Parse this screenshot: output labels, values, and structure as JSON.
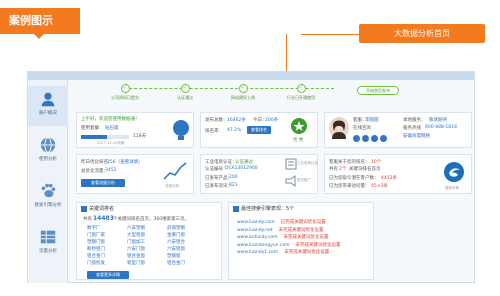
{
  "header": {
    "badge": "案例图示",
    "callout": "大数据分析首页"
  },
  "sidebar": {
    "items": [
      {
        "label": "账户概况",
        "icon": "user-icon"
      },
      {
        "label": "使用分析",
        "icon": "globe-icon"
      },
      {
        "label": "搜索引擎分析",
        "icon": "paw-icon"
      },
      {
        "label": "流量分析",
        "icon": "grid-icon"
      }
    ]
  },
  "steps": {
    "items": [
      "公司资料已提交",
      "认证通过",
      "网站建好上线",
      "行业已开通使用"
    ],
    "last": "开始首页发布"
  },
  "account": {
    "greeting": "上午好，欢迎您使用数据通！",
    "package_label": "使用套餐：",
    "package_value": "钻石版",
    "usage_pct": 0.55,
    "days": "118天",
    "expiry": "2017-11-15到期",
    "icon": "lightbulb-icon"
  },
  "stats": {
    "posts_label": "发布总数：",
    "posts_value": "16462条",
    "today_label": "今日：",
    "today_value": "200条",
    "rate_label": "排名率：",
    "rate_value": "47.2%",
    "rate_btn": "查看排名",
    "rank_label": "优 秀"
  },
  "advisor": {
    "label": "客服：",
    "name": "李圆圆",
    "phone_label": "电话：",
    "online_label": "在线咨询",
    "qq_label": "QQ咨询",
    "support": "本地服务：",
    "support_value": "敬请期待",
    "hotline_label": "服务热线",
    "hotline": "400-888-1818",
    "hotline_2": "安徽商盟网络"
  },
  "traffic": {
    "yesterday_label": "昨日优化排名：",
    "yesterday_value": "156（查看详情）",
    "total_label": "总优化流量：",
    "total_value": "3452",
    "btn": "查看流量分析",
    "chart_label": "流量分析"
  },
  "business": {
    "license_label": "工业电商认证：",
    "license_value": "认证通过",
    "cert_label": "认证编号：",
    "cert_value": "DCA13012900",
    "pages_label": "已发布产品：",
    "pages_value": "200",
    "news_label": "已发布资讯：",
    "news_value": "823",
    "icon1": "工业电商认证",
    "icon2": "发布推广"
  },
  "promo": {
    "line1_label": "客服关于您的排名：",
    "line1_value": "10个",
    "line2_label": "共有",
    "line2_value": "2个",
    "line2_tail": "关键词排名首页",
    "line3_label": "已为您吸引潜在客户数：",
    "line3_value": "4452条",
    "line4_label": "已为您带来访问量：",
    "line4_value": "45×3条",
    "logo": "搜索引擎"
  },
  "keywords": {
    "title": "关键词排名",
    "summary_pre": "共有",
    "summary_num": "14483",
    "summary_post": "个关键词排名首页，360搜索第三页。",
    "cols": [
      [
        "数字厂",
        "门窗厂家",
        "塑钢门窗",
        "断桥铝门",
        "铝合金门",
        "门窗批发"
      ],
      [
        "六安塑钢",
        "大型铝窗",
        "门窗加工",
        "六安门窗",
        "铝合金窗",
        "新型门窗"
      ],
      [
        "舒城塑钢",
        "金寨门窗",
        "六安铝合",
        "六安铝窗",
        "塑钢窗",
        "铝合金门"
      ]
    ],
    "btn": "查看更多详情"
  },
  "domains": {
    "title": "最佳搜索引擎表现：5个",
    "rows": [
      {
        "url": "www.luandy.com",
        "note": "已完成关键词优化设置"
      },
      {
        "url": "www.luandy.net",
        "note": "未完成关键词优化设置"
      },
      {
        "url": "www.anhuidy.com",
        "note": "未完成关键词优化设置"
      },
      {
        "url": "www.luandongyun.com",
        "note": "未完成关键词优化设置"
      },
      {
        "url": "www.luandy1.com",
        "note": "未完成关键词优化设置"
      }
    ]
  },
  "colors": {
    "accent": "#f47a1f",
    "brand": "#2e75c6",
    "ok": "#6cbf3a"
  }
}
